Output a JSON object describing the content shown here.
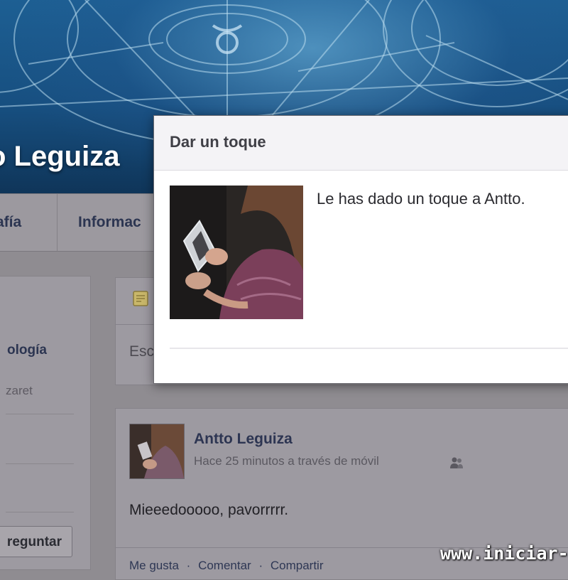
{
  "profile": {
    "name_partial": "o Leguiza",
    "tabs": [
      "afía",
      "Informac"
    ]
  },
  "left_column": {
    "title_partial": "ología",
    "subtitle_partial": "zaret",
    "ask_button_partial": "reguntar"
  },
  "composer": {
    "placeholder_partial": "Esc"
  },
  "post": {
    "author": "Antto Leguiza",
    "meta": "Hace 25 minutos a través de móvil",
    "text": "Mieeedooooo, pavorrrrr.",
    "actions": [
      "Me gusta",
      "·",
      "Comentar",
      "·",
      "Compartir"
    ]
  },
  "dialog": {
    "title": "Dar un toque",
    "message": "Le has dado un toque a Antto."
  },
  "watermark": "www.iniciar-",
  "colors": {
    "cover_blue": "#1d5f93",
    "link_navy": "#2c3551",
    "overlay_gray": "#9d9aa1",
    "dialog_header": "#f4f3f6"
  },
  "icons": {
    "composer": "status-note-icon",
    "privacy": "friends-icon"
  }
}
